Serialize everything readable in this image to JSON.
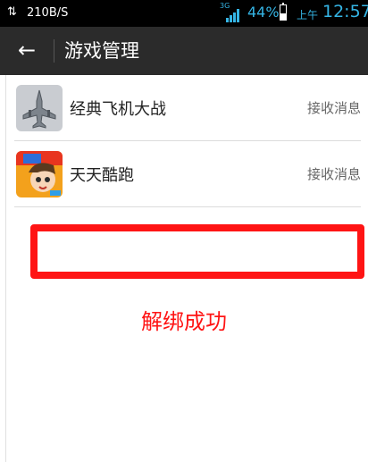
{
  "status_bar": {
    "speed": "210B/S",
    "network_type": "3G",
    "battery_percent": "44%",
    "battery_level": 0.44,
    "ampm": "上午",
    "time": "12:57"
  },
  "action_bar": {
    "back_icon": "arrow-left-icon",
    "title": "游戏管理"
  },
  "games": [
    {
      "name": "经典飞机大战",
      "action": "接收消息",
      "icon": "plane-game-icon"
    },
    {
      "name": "天天酷跑",
      "action": "接收消息",
      "icon": "parkour-game-icon"
    }
  ],
  "result": {
    "text": "解绑成功",
    "color": "#ff1414"
  },
  "colors": {
    "status_accent": "#35b5e5",
    "action_bar_bg": "#2b2b2b",
    "highlight": "#ff1414"
  }
}
